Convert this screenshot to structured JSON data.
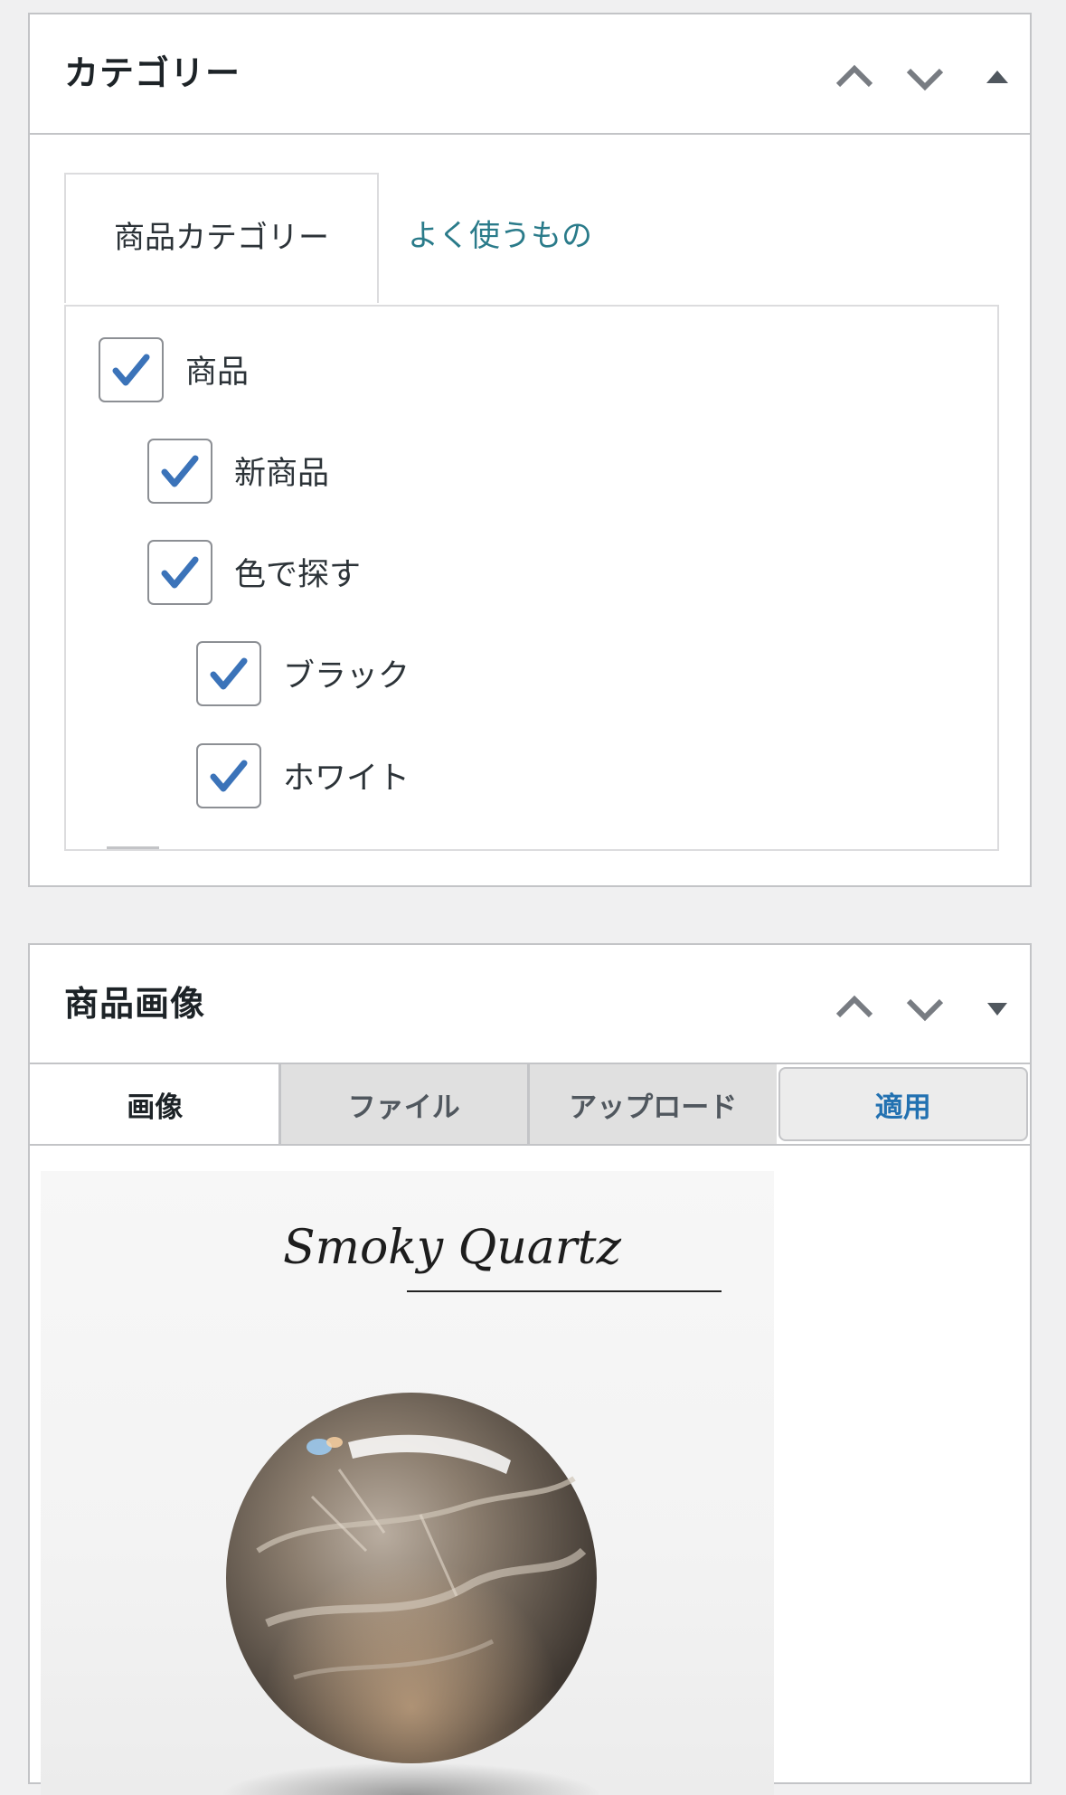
{
  "category_panel": {
    "title": "カテゴリー",
    "tabs": {
      "active": "商品カテゴリー",
      "other": "よく使うもの"
    },
    "items": [
      {
        "label": "商品",
        "checked": true,
        "level": 0
      },
      {
        "label": "新商品",
        "checked": true,
        "level": 1
      },
      {
        "label": "色で探す",
        "checked": true,
        "level": 1
      },
      {
        "label": "ブラック",
        "checked": true,
        "level": 2
      },
      {
        "label": "ホワイト",
        "checked": true,
        "level": 2
      }
    ]
  },
  "image_panel": {
    "title": "商品画像",
    "tabs": [
      "画像",
      "ファイル",
      "アップロード",
      "適用"
    ],
    "image": {
      "caption": "Smoky Quartz"
    }
  },
  "icons": {
    "move_up": "chevron-up-icon",
    "move_down": "chevron-down-icon",
    "collapse": "triangle-up-icon",
    "expand": "triangle-down-icon",
    "checkmark": "checkmark-icon"
  },
  "colors": {
    "checkmark": "#3b73b9",
    "link": "#2a7b8a",
    "apply": "#2271b1",
    "border": "#c3c4c7"
  }
}
